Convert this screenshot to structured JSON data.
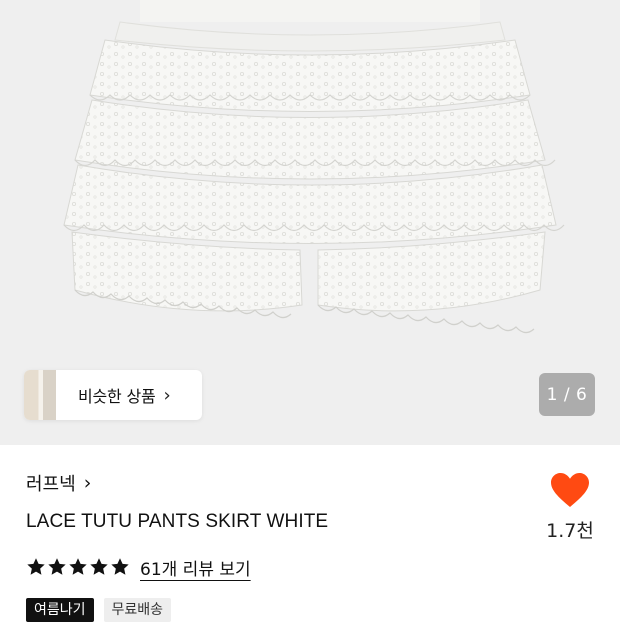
{
  "product_image": {
    "alt": ""
  },
  "similar": {
    "label": "비슷한 상품",
    "chevron": "›",
    "thumb_icon": "thumbnail-image"
  },
  "pager": {
    "text": "1 / 6"
  },
  "brand": {
    "name": "러프넥",
    "chevron": "›"
  },
  "product": {
    "title": "LACE TUTU PANTS SKIRT WHITE"
  },
  "like": {
    "count": "1.7천",
    "icon": "heart-icon",
    "color": "#FF4A12"
  },
  "rating": {
    "stars": 5,
    "max": 5,
    "review_link": "61개 리뷰 보기"
  },
  "tags": [
    {
      "label": "여름나기",
      "style": "dark"
    },
    {
      "label": "무료배송",
      "style": "light"
    }
  ],
  "colors": {
    "hero_bg": "#EFEFEF",
    "star": "#111111"
  }
}
